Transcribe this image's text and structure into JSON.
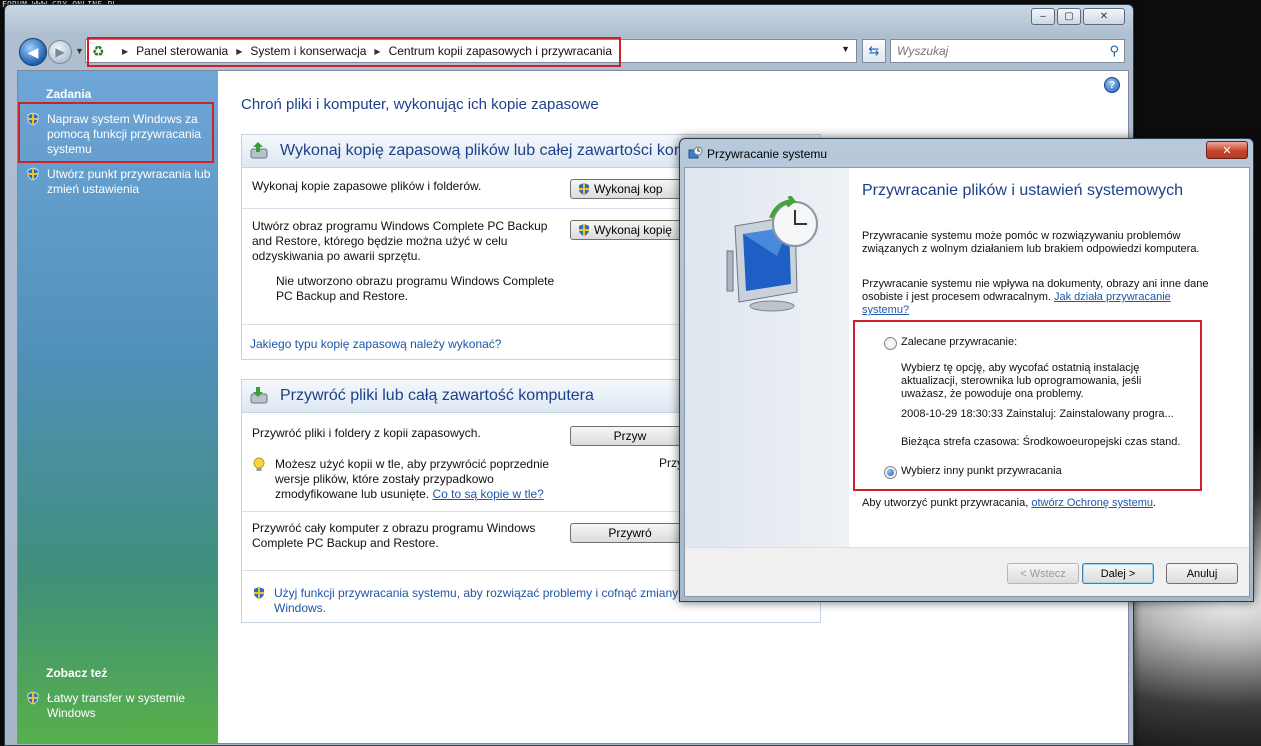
{
  "watermark": "FORUM WWW.GRY-ONLINE.PL",
  "colors": {
    "accent": "#1e3f8a",
    "link": "#1e56a8",
    "highlight": "#d0202a"
  },
  "window": {
    "controls": {
      "minimize": "‒",
      "maximize": "▢",
      "close": "✕"
    },
    "breadcrumbs": [
      "Panel sterowania",
      "System i konserwacja",
      "Centrum kopii zapasowych i przywracania"
    ],
    "search_placeholder": "Wyszukaj"
  },
  "sidebar": {
    "tasks_heading": "Zadania",
    "tasks": [
      {
        "label": "Napraw system Windows za pomocą funkcji przywracania systemu",
        "icon": "shield-icon"
      },
      {
        "label": "Utwórz punkt przywracania lub zmień ustawienia",
        "icon": "shield-icon"
      }
    ],
    "see_also_heading": "Zobacz też",
    "see_also": [
      {
        "label": "Łatwy transfer w systemie Windows",
        "icon": "shield-icon"
      }
    ]
  },
  "main": {
    "title": "Chroń pliki i komputer, wykonując ich kopie zapasowe",
    "backup": {
      "heading": "Wykonaj kopię zapasową plików lub całej zawartości kom",
      "row1_text": "Wykonaj kopie zapasowe plików i folderów.",
      "row1_button": "Wykonaj kop",
      "row2_text": "Utwórz obraz programu Windows Complete PC Backup and Restore, którego będzie można użyć w celu odzyskiwania po awarii sprzętu.",
      "row2_button": "Wykonaj kopię",
      "row2_note": "Nie utworzono obrazu programu Windows Complete PC Backup and Restore.",
      "help_link": "Jakiego typu kopię zapasową należy wykonać?"
    },
    "restore": {
      "heading": "Przywróć pliki lub całą zawartość komputera",
      "row1_text": "Przywróć pliki i foldery z kopii zapasowych.",
      "row1_button": "Przyw",
      "row1_link": "Przy",
      "tip_text": "Możesz użyć kopii w tle, aby przywrócić poprzednie wersje plików, które zostały przypadkowo zmodyfikowane lub usunięte.",
      "tip_link": "Co to są kopie w tle?",
      "row2_text": "Przywróć cały komputer z obrazu programu Windows Complete PC Backup and Restore.",
      "row2_button": "Przywró",
      "sysrestore_text": "Użyj funkcji przywracania systemu, aby rozwiązać problemy i cofnąć zmiany w",
      "sysrestore_text2": "Windows."
    }
  },
  "dialog": {
    "title": "Przywracanie systemu",
    "close": "✕",
    "heading": "Przywracanie plików i ustawień systemowych",
    "para1": "Przywracanie systemu może pomóc w rozwiązywaniu problemów związanych z wolnym działaniem lub brakiem odpowiedzi komputera.",
    "para2": "Przywracanie systemu nie wpływa na dokumenty, obrazy ani inne dane osobiste i jest procesem odwracalnym.",
    "para2_link": "Jak działa przywracanie systemu?",
    "option1_label": "Zalecane przywracanie:",
    "option1_desc": "Wybierz tę opcję, aby wycofać ostatnią instalację aktualizacji, sterownika lub oprogramowania, jeśli uważasz, że powoduje ona problemy.",
    "option1_point": "2008-10-29 18:30:33 Zainstaluj: Zainstalowany progra...",
    "option1_tz": "Bieżąca strefa czasowa: Środkowoeuropejski czas stand.",
    "option2_label": "Wybierz inny punkt przywracania",
    "selected_option": 2,
    "footer_text": "Aby utworzyć punkt przywracania,",
    "footer_link": "otwórz Ochronę systemu",
    "footer_end": ".",
    "buttons": {
      "back": "< Wstecz",
      "next": "Dalej >",
      "cancel": "Anuluj"
    }
  }
}
